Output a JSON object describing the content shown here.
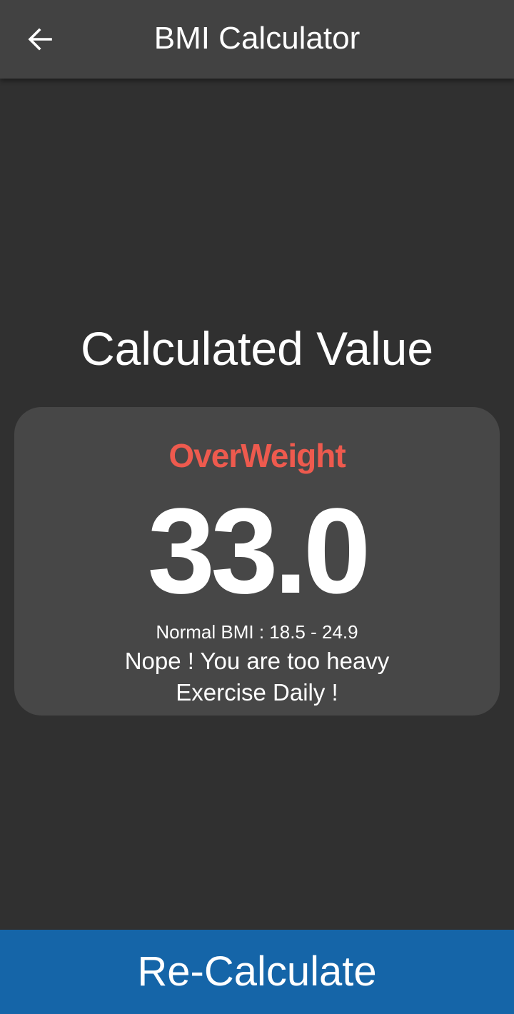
{
  "app_bar": {
    "title": "BMI Calculator",
    "back_icon": "arrow-left-icon"
  },
  "result": {
    "heading": "Calculated Value",
    "status": "OverWeight",
    "bmi": "33.0",
    "normal_range": "Normal BMI : 18.5 - 24.9",
    "advice_lines": [
      "Nope ! You are too heavy",
      "Exercise Daily !"
    ]
  },
  "actions": {
    "recalculate_label": "Re-Calculate"
  },
  "colors": {
    "background": "#303030",
    "app_bar": "#424242",
    "card": "#474747",
    "status_overweight": "#ee5a4e",
    "button": "#1565a8"
  }
}
